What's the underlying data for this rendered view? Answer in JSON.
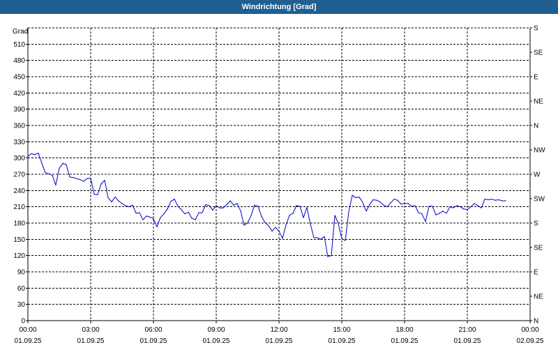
{
  "window": {
    "title": "Windrichtung [Grad]"
  },
  "colors": {
    "titlebar": "#1f5f92",
    "series": "#0000c8",
    "grid": "#000000"
  },
  "chart_data": {
    "type": "line",
    "title": "Windrichtung [Grad]",
    "ylabel": "Grad",
    "ylim": [
      0,
      540
    ],
    "yticks": [
      0,
      30,
      60,
      90,
      120,
      150,
      180,
      210,
      240,
      270,
      300,
      330,
      360,
      390,
      420,
      450,
      480,
      510
    ],
    "y2ticks": [
      {
        "label": "N",
        "value": 0
      },
      {
        "label": "NE",
        "value": 45
      },
      {
        "label": "E",
        "value": 90
      },
      {
        "label": "SE",
        "value": 135
      },
      {
        "label": "S",
        "value": 180
      },
      {
        "label": "SW",
        "value": 225
      },
      {
        "label": "W",
        "value": 270
      },
      {
        "label": "NW",
        "value": 315
      },
      {
        "label": "N",
        "value": 360
      },
      {
        "label": "NE",
        "value": 405
      },
      {
        "label": "E",
        "value": 450
      },
      {
        "label": "SE",
        "value": 495
      },
      {
        "label": "S",
        "value": 540
      }
    ],
    "xlim": [
      0,
      24
    ],
    "xticks": [
      {
        "time": "00:00",
        "date": "01.09.25",
        "hour": 0
      },
      {
        "time": "03:00",
        "date": "01.09.25",
        "hour": 3
      },
      {
        "time": "06:00",
        "date": "01.09.25",
        "hour": 6
      },
      {
        "time": "09:00",
        "date": "01.09.25",
        "hour": 9
      },
      {
        "time": "12:00",
        "date": "01.09.25",
        "hour": 12
      },
      {
        "time": "15:00",
        "date": "01.09.25",
        "hour": 15
      },
      {
        "time": "18:00",
        "date": "01.09.25",
        "hour": 18
      },
      {
        "time": "21:00",
        "date": "01.09.25",
        "hour": 21
      },
      {
        "time": "00:00",
        "date": "02.09.25",
        "hour": 24
      }
    ],
    "grid": true,
    "series": [
      {
        "points": [
          [
            0.0,
            303
          ],
          [
            0.17,
            308
          ],
          [
            0.33,
            306
          ],
          [
            0.5,
            309
          ],
          [
            0.67,
            290
          ],
          [
            0.83,
            273
          ],
          [
            1.0,
            271
          ],
          [
            1.17,
            268
          ],
          [
            1.33,
            250
          ],
          [
            1.5,
            281
          ],
          [
            1.67,
            290
          ],
          [
            1.83,
            288
          ],
          [
            2.0,
            265
          ],
          [
            2.17,
            264
          ],
          [
            2.33,
            262
          ],
          [
            2.5,
            260
          ],
          [
            2.67,
            257
          ],
          [
            2.83,
            262
          ],
          [
            3.0,
            263
          ],
          [
            3.17,
            233
          ],
          [
            3.33,
            232
          ],
          [
            3.5,
            252
          ],
          [
            3.67,
            259
          ],
          [
            3.83,
            227
          ],
          [
            4.0,
            219
          ],
          [
            4.17,
            228
          ],
          [
            4.33,
            221
          ],
          [
            4.5,
            216
          ],
          [
            4.67,
            212
          ],
          [
            4.83,
            210
          ],
          [
            5.0,
            213
          ],
          [
            5.17,
            198
          ],
          [
            5.33,
            199
          ],
          [
            5.5,
            186
          ],
          [
            5.67,
            193
          ],
          [
            5.83,
            191
          ],
          [
            6.0,
            188
          ],
          [
            6.17,
            173
          ],
          [
            6.33,
            190
          ],
          [
            6.5,
            197
          ],
          [
            6.67,
            206
          ],
          [
            6.83,
            220
          ],
          [
            7.0,
            224
          ],
          [
            7.17,
            211
          ],
          [
            7.33,
            205
          ],
          [
            7.5,
            197
          ],
          [
            7.67,
            200
          ],
          [
            7.83,
            189
          ],
          [
            8.0,
            186
          ],
          [
            8.17,
            199
          ],
          [
            8.33,
            199
          ],
          [
            8.5,
            214
          ],
          [
            8.67,
            212
          ],
          [
            8.83,
            204
          ],
          [
            9.0,
            212
          ],
          [
            9.17,
            208
          ],
          [
            9.33,
            208
          ],
          [
            9.5,
            214
          ],
          [
            9.67,
            221
          ],
          [
            9.83,
            213
          ],
          [
            10.0,
            216
          ],
          [
            10.17,
            202
          ],
          [
            10.33,
            176
          ],
          [
            10.5,
            180
          ],
          [
            10.67,
            194
          ],
          [
            10.83,
            213
          ],
          [
            11.0,
            211
          ],
          [
            11.17,
            192
          ],
          [
            11.33,
            181
          ],
          [
            11.5,
            175
          ],
          [
            11.67,
            165
          ],
          [
            11.83,
            172
          ],
          [
            12.0,
            165
          ],
          [
            12.17,
            152
          ],
          [
            12.33,
            176
          ],
          [
            12.5,
            194
          ],
          [
            12.67,
            198
          ],
          [
            12.83,
            212
          ],
          [
            13.0,
            211
          ],
          [
            13.17,
            190
          ],
          [
            13.33,
            209
          ],
          [
            13.5,
            178
          ],
          [
            13.67,
            153
          ],
          [
            13.83,
            153
          ],
          [
            14.0,
            150
          ],
          [
            14.17,
            155
          ],
          [
            14.33,
            118
          ],
          [
            14.5,
            120
          ],
          [
            14.67,
            194
          ],
          [
            14.83,
            180
          ],
          [
            15.0,
            151
          ],
          [
            15.17,
            148
          ],
          [
            15.33,
            200
          ],
          [
            15.5,
            231
          ],
          [
            15.67,
            227
          ],
          [
            15.83,
            228
          ],
          [
            16.0,
            218
          ],
          [
            16.17,
            202
          ],
          [
            16.33,
            214
          ],
          [
            16.5,
            223
          ],
          [
            16.67,
            222
          ],
          [
            16.83,
            219
          ],
          [
            17.0,
            213
          ],
          [
            17.17,
            210
          ],
          [
            17.33,
            217
          ],
          [
            17.5,
            224
          ],
          [
            17.67,
            222
          ],
          [
            17.83,
            215
          ],
          [
            18.0,
            216
          ],
          [
            18.17,
            216
          ],
          [
            18.33,
            211
          ],
          [
            18.5,
            212
          ],
          [
            18.67,
            199
          ],
          [
            18.83,
            197
          ],
          [
            19.0,
            183
          ],
          [
            19.17,
            211
          ],
          [
            19.33,
            211
          ],
          [
            19.5,
            195
          ],
          [
            19.67,
            198
          ],
          [
            19.83,
            202
          ],
          [
            20.0,
            198
          ],
          [
            20.17,
            210
          ],
          [
            20.33,
            208
          ],
          [
            20.5,
            212
          ],
          [
            20.67,
            210
          ],
          [
            20.83,
            206
          ],
          [
            21.0,
            205
          ],
          [
            21.17,
            210
          ],
          [
            21.33,
            216
          ],
          [
            21.5,
            212
          ],
          [
            21.67,
            208
          ],
          [
            21.83,
            224
          ],
          [
            22.0,
            223
          ],
          [
            22.17,
            224
          ],
          [
            22.33,
            222
          ],
          [
            22.5,
            223
          ],
          [
            22.67,
            221
          ],
          [
            22.83,
            221
          ]
        ]
      }
    ]
  }
}
